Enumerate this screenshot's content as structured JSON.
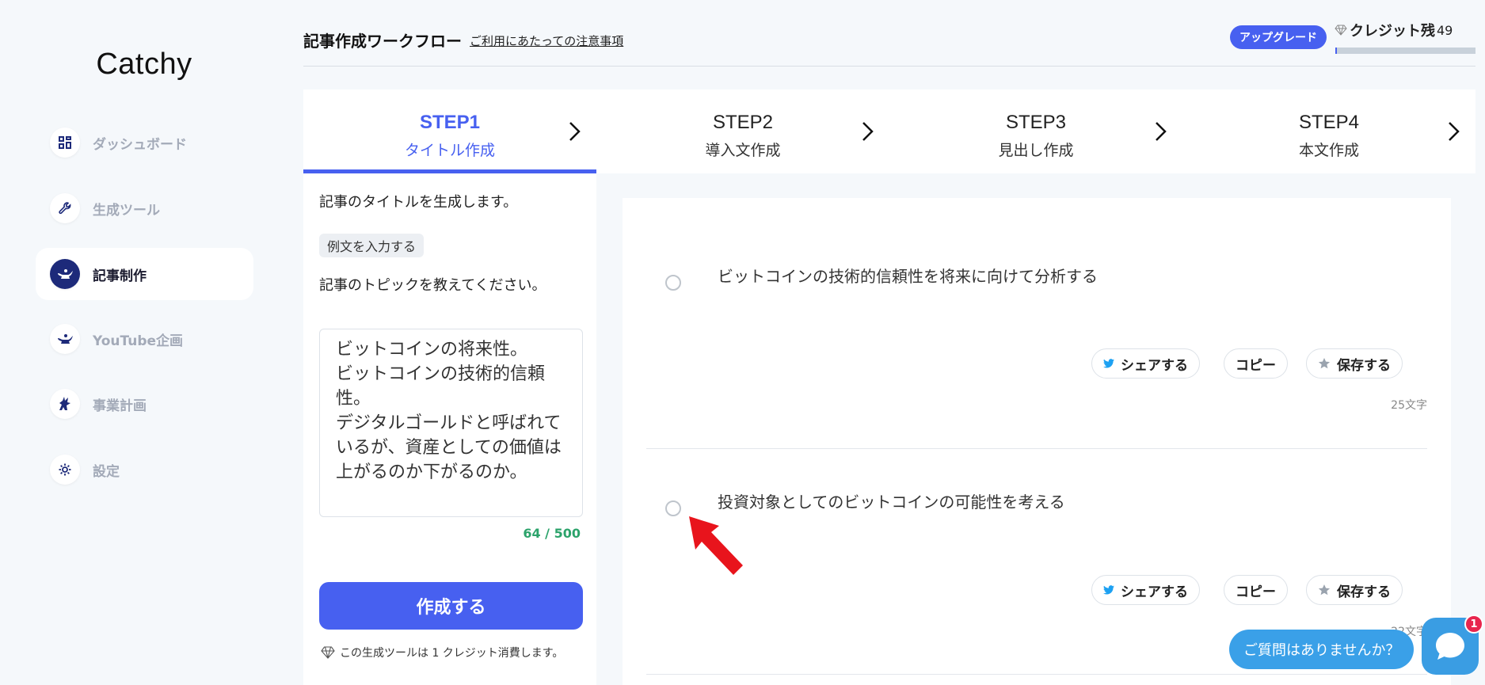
{
  "app": {
    "logo": "Catchy"
  },
  "sidebar": {
    "items": [
      {
        "label": "ダッシュボード",
        "icon": "dashboard-icon",
        "active": false
      },
      {
        "label": "生成ツール",
        "icon": "wrench-icon",
        "active": false
      },
      {
        "label": "記事制作",
        "icon": "genie-lamp-icon",
        "active": true
      },
      {
        "label": "YouTube企画",
        "icon": "genie-lamp-icon",
        "active": false
      },
      {
        "label": "事業計画",
        "icon": "unicorn-icon",
        "active": false
      },
      {
        "label": "設定",
        "icon": "gear-icon",
        "active": false
      }
    ]
  },
  "header": {
    "title": "記事作成ワークフロー",
    "notice_link": "ご利用にあたっての注意事項",
    "upgrade_label": "アップグレード",
    "credit_label": "クレジット残",
    "credit_value": "49",
    "credit_level": 0.01
  },
  "steps": [
    {
      "num": "STEP1",
      "label": "タイトル作成",
      "active": true
    },
    {
      "num": "STEP2",
      "label": "導入文作成",
      "active": false
    },
    {
      "num": "STEP3",
      "label": "見出し作成",
      "active": false
    },
    {
      "num": "STEP4",
      "label": "本文作成",
      "active": false
    }
  ],
  "input_panel": {
    "description": "記事のタイトルを生成します。",
    "example_button": "例文を入力する",
    "topic_label": "記事のトピックを教えてください。",
    "topic_value": "ビットコインの将来性。\nビットコインの技術的信頼性。\nデジタルゴールドと呼ばれているが、資産としての価値は上がるのか下がるのか。",
    "char_count": "64 / 500",
    "create_button": "作成する",
    "credit_note": "この生成ツールは 1 クレジット消費します。"
  },
  "results": {
    "share_label": "シェアする",
    "copy_label": "コピー",
    "save_label": "保存する",
    "items": [
      {
        "text": "ビットコインの技術的信頼性を将来に向けて分析する",
        "length": "25文字"
      },
      {
        "text": "投資対象としてのビットコインの可能性を考える",
        "length": "22文字"
      }
    ]
  },
  "chat": {
    "bubble": "ご質問はありませんか？",
    "badge": "1"
  },
  "colors": {
    "accent": "#4760f0",
    "count_green": "#2ca36b",
    "chat_blue": "#3aa0e8",
    "annotation_red": "#e8141c"
  }
}
